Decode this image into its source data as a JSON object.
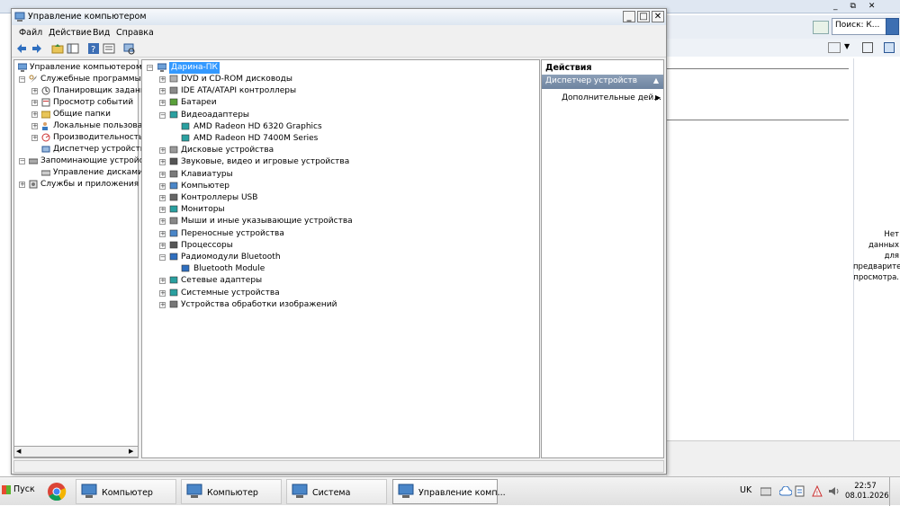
{
  "background_window": {
    "search_placeholder": "Поиск: К...",
    "preview_text": "Нет данных для предварительного просмотра."
  },
  "window": {
    "title": "Управление компьютером",
    "menu": [
      "Файл",
      "Действие",
      "Вид",
      "Справка"
    ],
    "toolbar_icons": [
      "back-icon",
      "forward-icon",
      "folder-up-icon",
      "console-tree-icon",
      "help-icon",
      "properties-icon",
      "device-scan-icon"
    ]
  },
  "left_tree": {
    "root": "Управление компьютером (л",
    "utilities": "Служебные программы",
    "scheduler": "Планировщик заданий",
    "event_viewer": "Просмотр событий",
    "shared_folders": "Общие папки",
    "local_users": "Локальные пользовате",
    "performance": "Производительность",
    "device_manager": "Диспетчер устройств",
    "storage": "Запоминающие устройст",
    "disk_management": "Управление дисками",
    "services": "Службы и приложения"
  },
  "device_tree": {
    "computer_name": "Дарина-ПК",
    "categories": [
      {
        "label": "DVD и CD-ROM дисководы",
        "expanded": false,
        "icon": "dvd-drive-icon"
      },
      {
        "label": "IDE ATA/ATAPI контроллеры",
        "expanded": false,
        "icon": "ide-controller-icon"
      },
      {
        "label": "Батареи",
        "expanded": false,
        "icon": "battery-icon"
      },
      {
        "label": "Видеоадаптеры",
        "expanded": true,
        "icon": "display-adapter-icon",
        "children": [
          "AMD Radeon HD 6320 Graphics",
          "AMD Radeon HD 7400M Series"
        ]
      },
      {
        "label": "Дисковые устройства",
        "expanded": false,
        "icon": "disk-drive-icon"
      },
      {
        "label": "Звуковые, видео и игровые устройства",
        "expanded": false,
        "icon": "sound-icon"
      },
      {
        "label": "Клавиатуры",
        "expanded": false,
        "icon": "keyboard-icon"
      },
      {
        "label": "Компьютер",
        "expanded": false,
        "icon": "computer-icon"
      },
      {
        "label": "Контроллеры USB",
        "expanded": false,
        "icon": "usb-icon"
      },
      {
        "label": "Мониторы",
        "expanded": false,
        "icon": "monitor-icon"
      },
      {
        "label": "Мыши и иные указывающие устройства",
        "expanded": false,
        "icon": "mouse-icon"
      },
      {
        "label": "Переносные устройства",
        "expanded": false,
        "icon": "portable-device-icon"
      },
      {
        "label": "Процессоры",
        "expanded": false,
        "icon": "processor-icon"
      },
      {
        "label": "Радиомодули Bluetooth",
        "expanded": true,
        "icon": "bluetooth-icon",
        "children": [
          "Bluetooth Module"
        ]
      },
      {
        "label": "Сетевые адаптеры",
        "expanded": false,
        "icon": "network-adapter-icon"
      },
      {
        "label": "Системные устройства",
        "expanded": false,
        "icon": "system-device-icon"
      },
      {
        "label": "Устройства обработки изображений",
        "expanded": false,
        "icon": "imaging-device-icon"
      }
    ]
  },
  "actions": {
    "title": "Действия",
    "header": "Диспетчер устройств",
    "more": "Дополнительные дей..."
  },
  "taskbar": {
    "start": "Пуск",
    "tasks": [
      "Компьютер",
      "Компьютер",
      "Система",
      "Управление комп..."
    ],
    "lang": "UK",
    "time": "22:57",
    "date": "08.01.2026"
  },
  "colors": {
    "selection": "#3399ff",
    "title_gradient": "#dde6f1",
    "actions_header": "#7a8ea9"
  }
}
